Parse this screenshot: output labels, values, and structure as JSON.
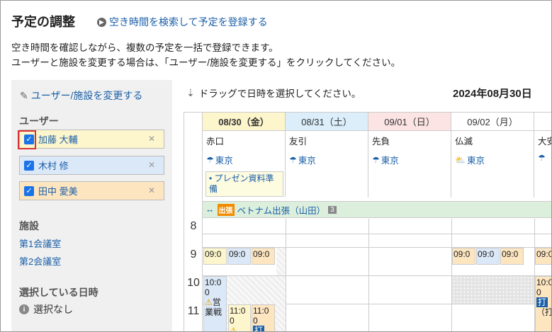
{
  "header": {
    "title": "予定の調整",
    "search_link": "空き時間を検索して予定を登録する",
    "desc_line1": "空き時間を確認しながら、複数の予定を一括で登録できます。",
    "desc_line2": "ユーザーと施設を変更する場合は、「ユーザー/施設を変更する」をクリックしてください。"
  },
  "sidebar": {
    "edit_link": "ユーザー/施設を変更する",
    "users_title": "ユーザー",
    "users": [
      {
        "name": "加藤 大輔",
        "color": "#fdf6cc"
      },
      {
        "name": "木村 修",
        "color": "#dbe8f8"
      },
      {
        "name": "田中 愛美",
        "color": "#fde5c0"
      }
    ],
    "remove_glyph": "✕",
    "facilities_title": "施設",
    "facilities": [
      "第1会議室",
      "第2会議室"
    ],
    "selected_title": "選択している日時",
    "selected_none": "選択なし"
  },
  "calendar": {
    "drag_hint": "ドラッグで日時を選択してください。",
    "current_date": "2024年08月30日",
    "days": [
      {
        "label": "08/30（金）",
        "rokuyo": "赤口",
        "weather": "東京",
        "bg": "#fdf6cc"
      },
      {
        "label": "08/31（土）",
        "rokuyo": "友引",
        "weather": "東京",
        "bg": "#dbeefa"
      },
      {
        "label": "09/01（日）",
        "rokuyo": "先負",
        "weather": "東京",
        "bg": "#fde4e4"
      },
      {
        "label": "09/02（月）",
        "rokuyo": "仏滅",
        "weather": "東京",
        "bg": "#ffffff"
      },
      {
        "label": "",
        "rokuyo": "大安",
        "weather": "",
        "bg": "#ffffff"
      }
    ],
    "memo": "プレゼン資料準備",
    "band_badge": "出張",
    "band_text": "ベトナム出張（山田）",
    "band_count": "3",
    "hours": [
      "8",
      "9",
      "10",
      "11"
    ],
    "ev_time_9": "09:0",
    "ev_time_10": "10:0",
    "ev_time_11": "11:0",
    "ev_zero": "0",
    "ev_eigyo": "営",
    "ev_eigyo2": "業戦",
    "ev_utsu": "打",
    "ev_kakko": "（打"
  }
}
